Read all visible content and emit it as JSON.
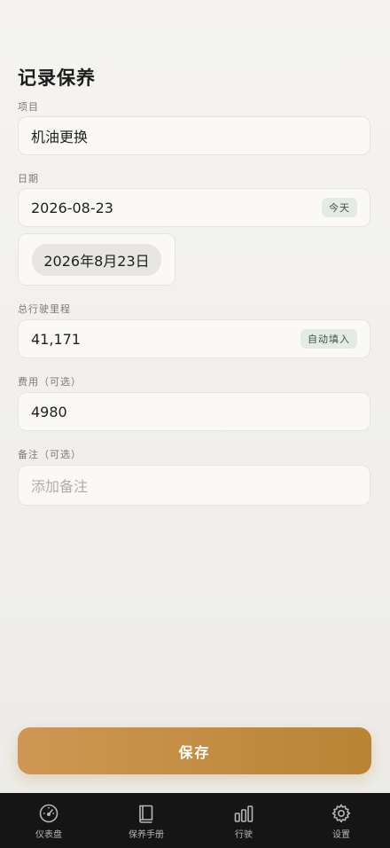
{
  "header": {
    "title": "记录保养"
  },
  "item": {
    "label": "项目",
    "value": "机油更换"
  },
  "date": {
    "label": "日期",
    "value": "2026-08-23",
    "today_chip": "今天",
    "picker_value": "2026年8月23日"
  },
  "mileage": {
    "label": "总行驶里程",
    "value": "41,171",
    "auto_chip": "自动填入"
  },
  "cost": {
    "label": "费用（可选）",
    "value": "4980"
  },
  "notes": {
    "label": "备注（可选）",
    "placeholder": "添加备注"
  },
  "actions": {
    "save_label": "保存"
  },
  "tabbar": {
    "items": [
      {
        "label": "仪表盘",
        "icon": "gauge-icon"
      },
      {
        "label": "保养手册",
        "icon": "book-icon"
      },
      {
        "label": "行驶",
        "icon": "bar-chart-icon"
      },
      {
        "label": "设置",
        "icon": "gear-icon"
      }
    ]
  },
  "colors": {
    "accent_start": "#cf9753",
    "accent_end": "#b98434",
    "tabbar_bg": "#151515",
    "chip_bg": "#e4ebe5"
  }
}
